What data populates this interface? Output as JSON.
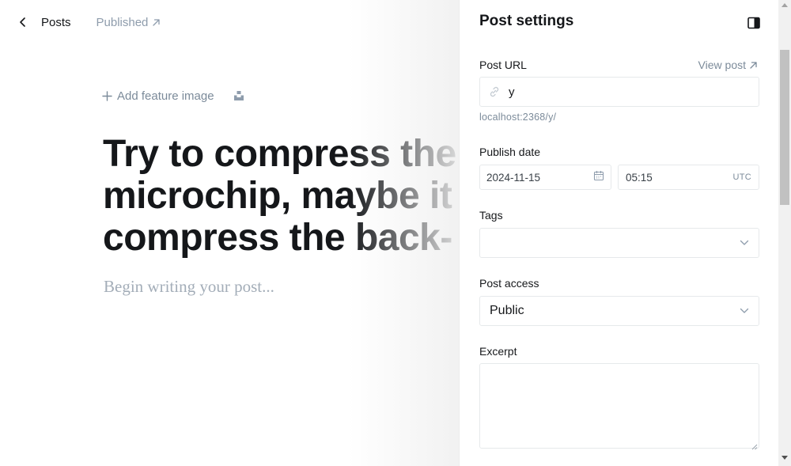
{
  "editor": {
    "back_label": "Posts",
    "status_label": "Published",
    "add_feature_image": "Add feature image",
    "title_lines": [
      "Try to compress the",
      "microchip, maybe it",
      "compress the back-"
    ],
    "body_placeholder": "Begin writing your post..."
  },
  "settings": {
    "title": "Post settings",
    "post_url": {
      "label": "Post URL",
      "view_post": "View post",
      "value": "y",
      "hint": "localhost:2368/y/"
    },
    "publish_date": {
      "label": "Publish date",
      "date": "2024-11-15",
      "time": "05:15",
      "timezone": "UTC"
    },
    "tags": {
      "label": "Tags"
    },
    "post_access": {
      "label": "Post access",
      "selected": "Public"
    },
    "excerpt": {
      "label": "Excerpt"
    }
  },
  "colors": {
    "text": "#15171a",
    "muted": "#7c8b9a",
    "border": "#e6e9eb",
    "placeholder": "#a3adb8"
  }
}
